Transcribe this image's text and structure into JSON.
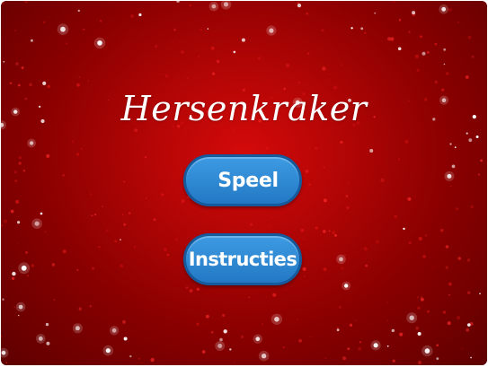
{
  "game": {
    "title": "Hersenkraker",
    "play_label": "Speel",
    "instructions_label": "Instructies"
  },
  "colors": {
    "background_center": "#d40a0a",
    "background_edge": "#5e0000",
    "button_fill": "#2f89d4",
    "button_border": "#155a9c",
    "text": "#ffffff"
  }
}
